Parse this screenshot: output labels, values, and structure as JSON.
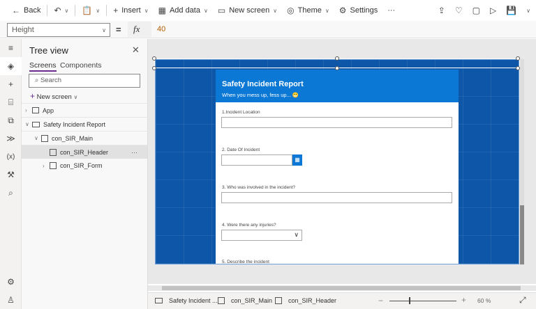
{
  "toolbar": {
    "back": "Back",
    "insert": "Insert",
    "add_data": "Add data",
    "new_screen": "New screen",
    "theme": "Theme",
    "settings": "Settings",
    "more": "···"
  },
  "formula": {
    "property": "Height",
    "equals": "=",
    "fx": "fx",
    "value": "40"
  },
  "tree": {
    "title": "Tree view",
    "tabs": [
      "Screens",
      "Components"
    ],
    "search_placeholder": "Search",
    "new_screen": "New screen",
    "nodes": [
      "App",
      "Safety Incident Report",
      "con_SIR_Main",
      "con_SIR_Header",
      "con_SIR_Form"
    ],
    "more": "···"
  },
  "form": {
    "title": "Safety Incident Report",
    "subtitle": "When you mess up, fess up... 😬",
    "fields": [
      "1.Incident Location",
      "2. Date Of Incident",
      "3. Who was involved in the incident?",
      "4. Were there any injuries?",
      "5. Describe the incident"
    ]
  },
  "status": {
    "crumbs": [
      "Safety Incident ...",
      "con_SIR_Main",
      "con_SIR_Header"
    ],
    "zoom": "60",
    "zoom_unit": "%",
    "zoom_level": 60
  },
  "colors": {
    "accent": "#0a78d4",
    "canvas": "#0d56a8"
  }
}
